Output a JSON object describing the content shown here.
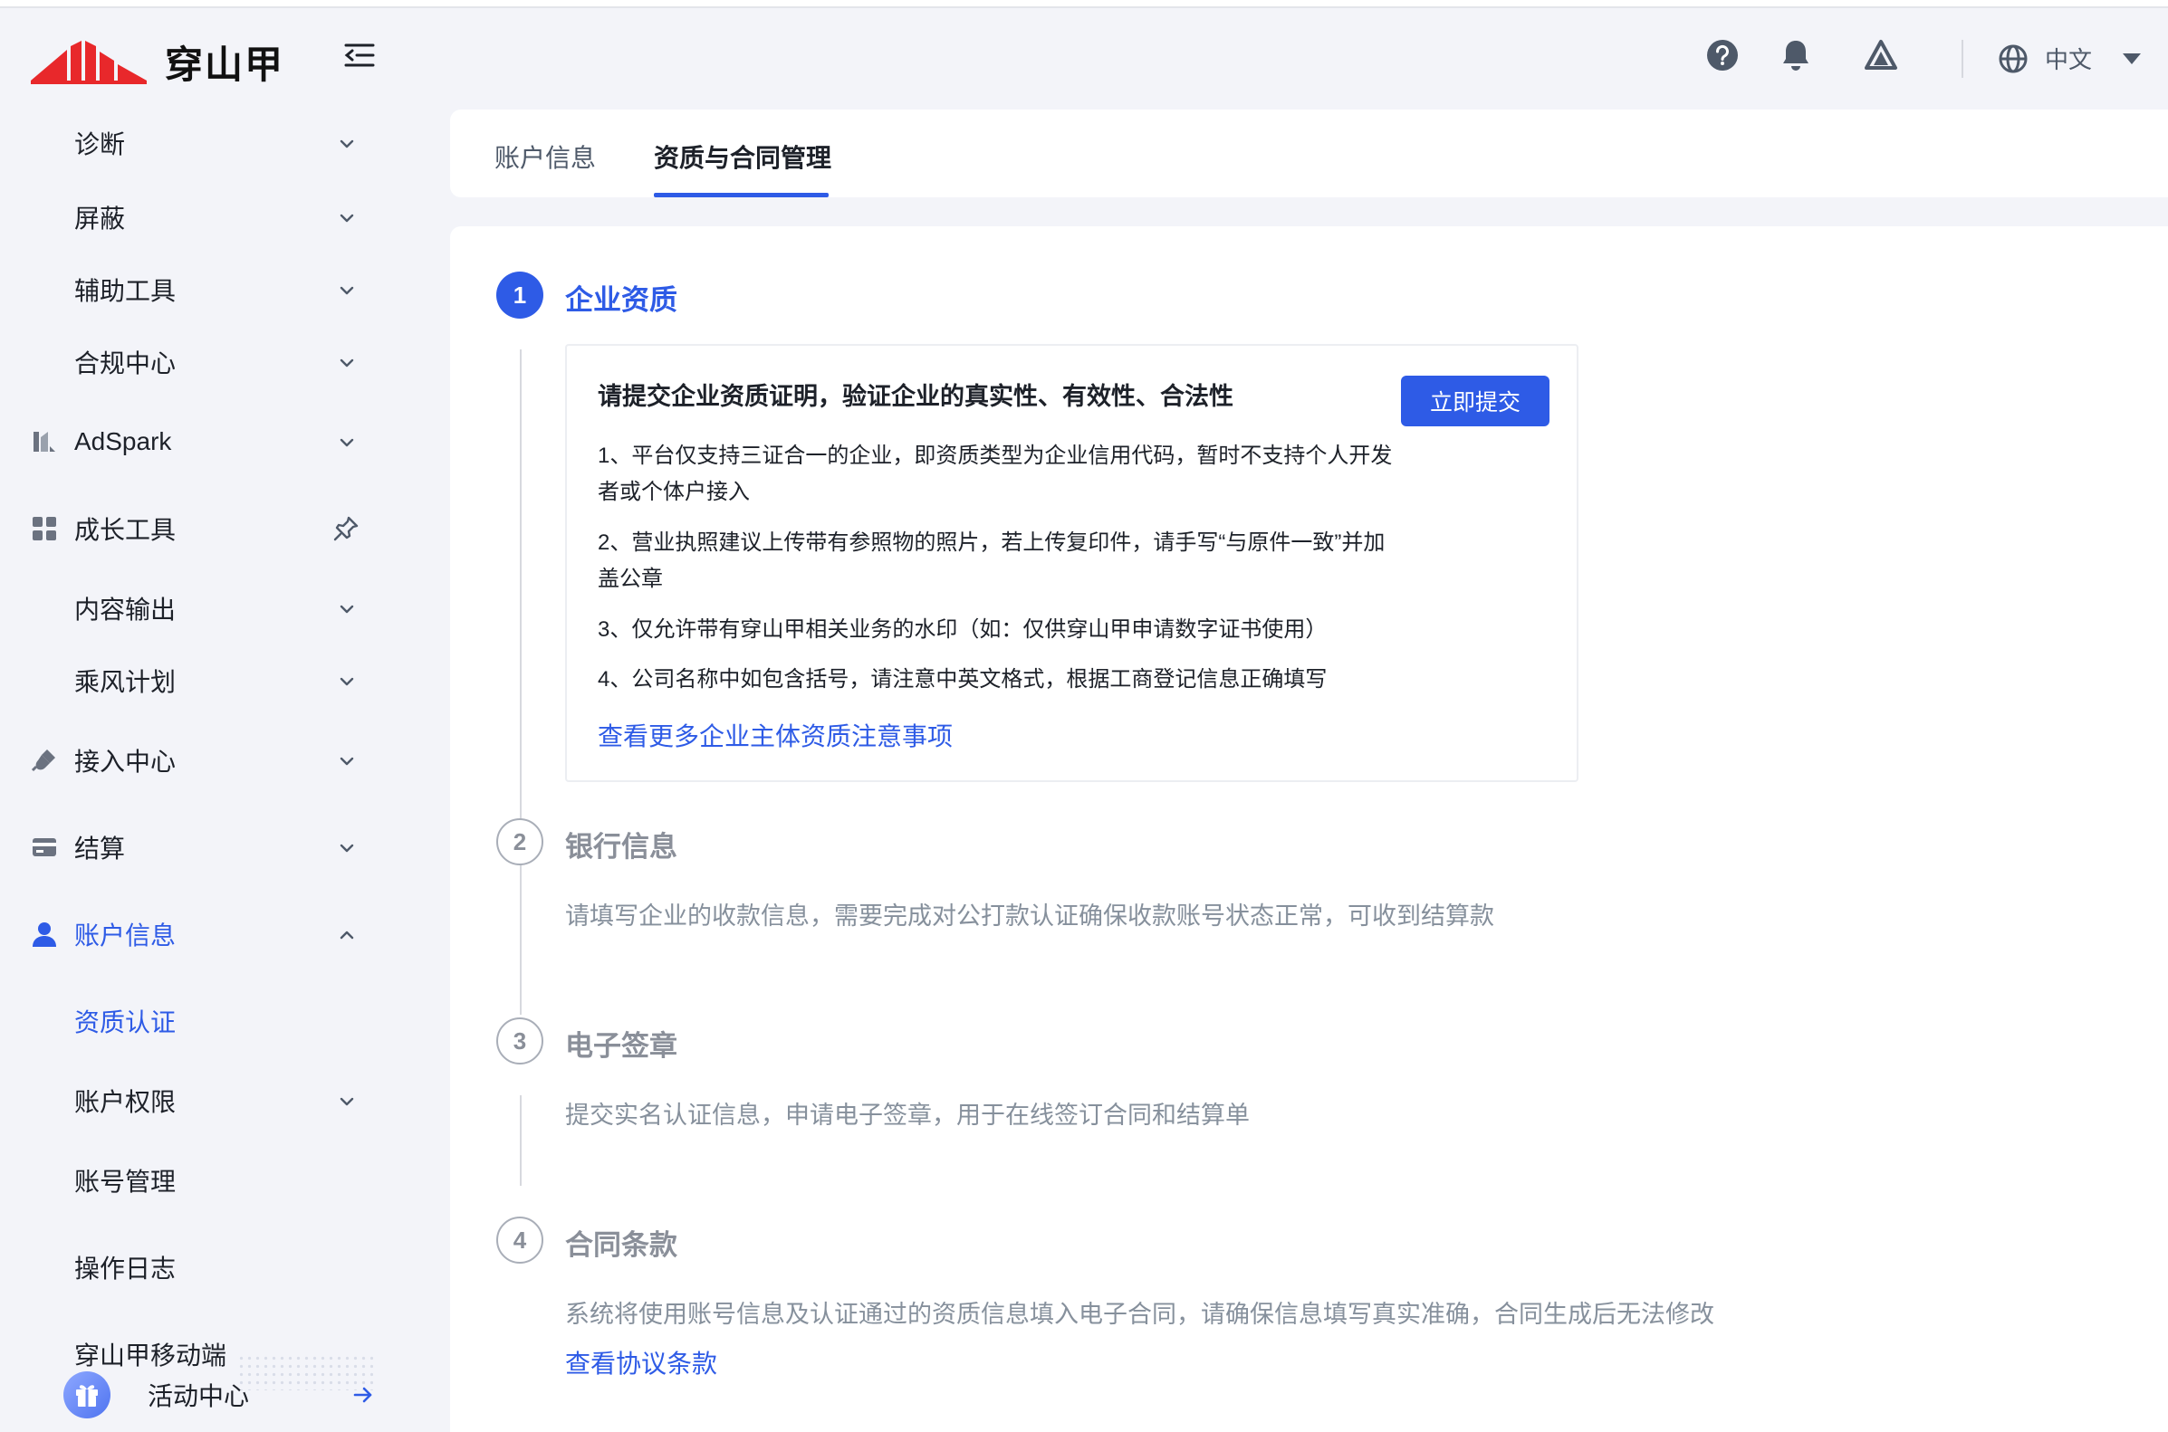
{
  "header": {
    "logo_text": "穿山甲",
    "language": "中文",
    "icons": [
      "help-icon",
      "bell-icon",
      "app-icon",
      "globe-icon"
    ]
  },
  "sidebar": {
    "items": [
      {
        "label": "诊断",
        "icon": "",
        "control": "chevron-down"
      },
      {
        "label": "屏蔽",
        "icon": "",
        "control": "chevron-down"
      },
      {
        "label": "辅助工具",
        "icon": "",
        "control": "chevron-down"
      },
      {
        "label": "合规中心",
        "icon": "",
        "control": "chevron-down"
      },
      {
        "label": "AdSpark",
        "icon": "adspark-icon",
        "control": "chevron-down"
      },
      {
        "label": "成长工具",
        "icon": "grid-icon",
        "control": "pin"
      },
      {
        "label": "内容输出",
        "icon": "",
        "control": "chevron-down"
      },
      {
        "label": "乘风计划",
        "icon": "",
        "control": "chevron-down"
      },
      {
        "label": "接入中心",
        "icon": "plug-icon",
        "control": "chevron-down"
      },
      {
        "label": "结算",
        "icon": "card-icon",
        "control": "chevron-down"
      },
      {
        "label": "账户信息",
        "icon": "user-icon",
        "control": "chevron-up",
        "active": true
      },
      {
        "label": "资质认证",
        "icon": "",
        "control": "",
        "active": true
      },
      {
        "label": "账户权限",
        "icon": "",
        "control": "chevron-down"
      },
      {
        "label": "账号管理",
        "icon": "",
        "control": ""
      },
      {
        "label": "操作日志",
        "icon": "",
        "control": ""
      },
      {
        "label": "穿山甲移动端",
        "icon": "",
        "control": ""
      }
    ],
    "activity_label": "活动中心"
  },
  "tabs": [
    {
      "label": "账户信息",
      "active": false
    },
    {
      "label": "资质与合同管理",
      "active": true
    }
  ],
  "steps": [
    {
      "num": "1",
      "title": "企业资质",
      "box": {
        "title": "请提交企业资质证明，验证企业的真实性、有效性、合法性",
        "button": "立即提交",
        "rules": [
          "1、平台仅支持三证合一的企业，即资质类型为企业信用代码，暂时不支持个人开发者或个体户接入",
          "2、营业执照建议上传带有参照物的照片，若上传复印件，请手写“与原件一致”并加盖公章",
          "3、仅允许带有穿山甲相关业务的水印（如：仅供穿山甲申请数字证书使用）",
          "4、公司名称中如包含括号，请注意中英文格式，根据工商登记信息正确填写"
        ],
        "link": "查看更多企业主体资质注意事项"
      }
    },
    {
      "num": "2",
      "title": "银行信息",
      "desc": "请填写企业的收款信息，需要完成对公打款认证确保收款账号状态正常，可收到结算款"
    },
    {
      "num": "3",
      "title": "电子签章",
      "desc": "提交实名认证信息，申请电子签章，用于在线签订合同和结算单"
    },
    {
      "num": "4",
      "title": "合同条款",
      "desc": "系统将使用账号信息及认证通过的资质信息填入电子合同，请确保信息填写真实准确，合同生成后无法修改",
      "link": "查看协议条款"
    }
  ],
  "colors": {
    "accent": "#2e5be6",
    "background": "#f3f4f9",
    "muted": "#86909c",
    "brand_red": "#e8282b"
  }
}
